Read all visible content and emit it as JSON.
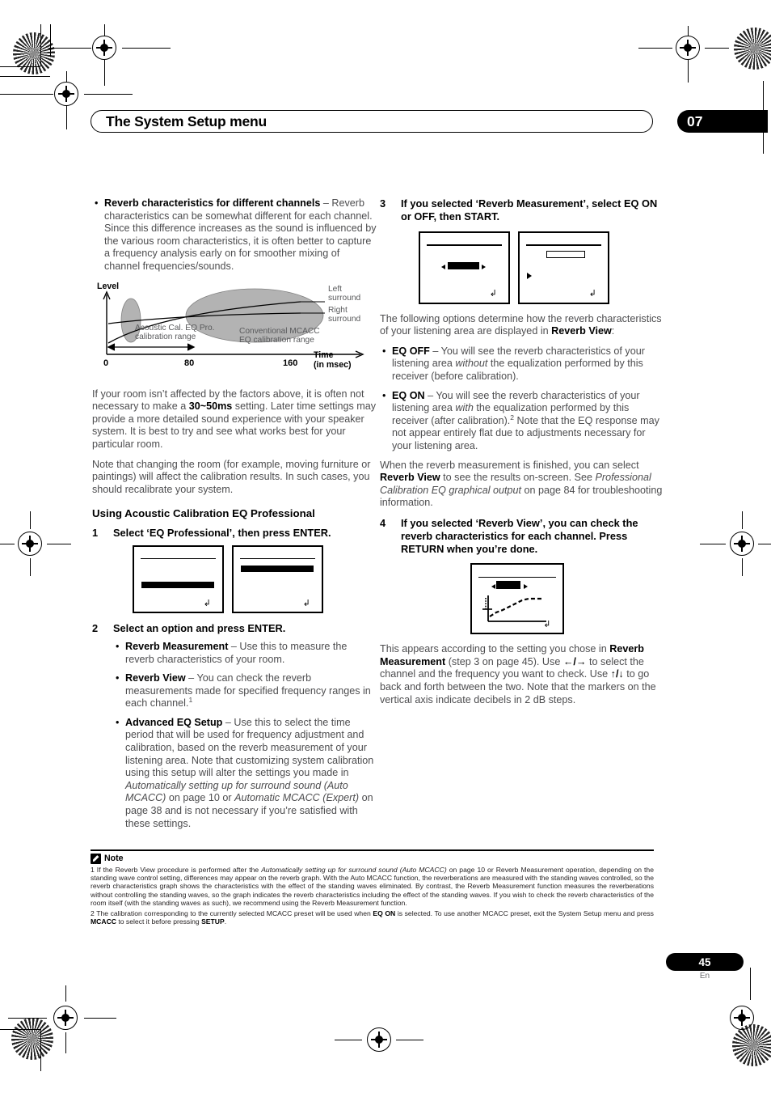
{
  "header": {
    "title": "The System Setup menu",
    "chapter": "07"
  },
  "page_footer": {
    "number": "45",
    "language": "En"
  },
  "left_column": {
    "bullet_reverb_channels": {
      "term": "Reverb characteristics for different channels",
      "dash": " – ",
      "text": "Reverb characteristics can be somewhat different for each channel. Since this difference increases as the sound is influenced by the various room characteristics, it is often better to capture a frequency analysis early on for smoother mixing of channel frequencies/sounds."
    },
    "diagram": {
      "y_axis_label": "Level",
      "x_axis_label": "Time",
      "x_axis_unit": "(in msec)",
      "x_ticks": [
        "0",
        "80",
        "160"
      ],
      "label_left_surround": "Left\nsurround",
      "label_left_surround_line1": "Left",
      "label_left_surround_line2": "surround",
      "label_right_surround_line1": "Right",
      "label_right_surround_line2": "surround",
      "label_acoustic_line1": "Acoustic Cal. EQ Pro.",
      "label_acoustic_line2": "calibration range",
      "label_conventional_line1": "Conventional MCACC",
      "label_conventional_line2": "EQ calibration range"
    },
    "para_room_factors_a": "If your room isn’t affected by the factors above, it is often not necessary to make a ",
    "para_room_factors_b": "30~50ms",
    "para_room_factors_c": " setting. Later time settings may provide a more detailed sound experience with your speaker system. It is best to try and see what works best for your particular room.",
    "para_changing_room": "Note that changing the room (for example, moving furniture or paintings) will affect the calibration results. In such cases, you should recalibrate your system.",
    "subhead_using": "Using Acoustic Calibration EQ Professional",
    "step1": {
      "num": "1",
      "text": "Select ‘EQ Professional’, then press ENTER."
    },
    "step2": {
      "num": "2",
      "text": "Select an option and press ENTER."
    },
    "step2_bullets": [
      {
        "term": "Reverb Measurement",
        "dash": " – ",
        "text": "Use this to measure the reverb characteristics of your room."
      },
      {
        "term": "Reverb View",
        "dash": " – ",
        "text": "You can check the reverb measurements made for specified frequency ranges in each channel.",
        "footnote_ref": "1"
      },
      {
        "term": "Advanced EQ Setup",
        "dash": " – ",
        "text_1": "Use this to select the time period that will be used for frequency adjustment and calibration, based on the reverb measurement of your listening area. Note that customizing system calibration using this setup will alter the settings you made in ",
        "italic_1": "Automatically setting up for surround sound (Auto MCACC)",
        "text_2": " on page 10 or ",
        "italic_2": "Automatic MCACC (Expert)",
        "text_3": " on page 38 and is not necessary if you’re satisfied with these settings."
      }
    ]
  },
  "right_column": {
    "step3": {
      "num": "3",
      "text": "If you selected ‘Reverb Measurement’, select EQ ON or OFF, then START."
    },
    "para_following_a": "The following options determine how the reverb characteristics of your listening area are displayed in ",
    "para_following_b": "Reverb View",
    "para_following_c": ":",
    "eq_bullets": [
      {
        "term": "EQ OFF",
        "dash": " – ",
        "text_1": "You will see the reverb characteristics of your listening area ",
        "italic_1": "without",
        "text_2": " the equalization performed by this receiver (before calibration)."
      },
      {
        "term": "EQ ON",
        "dash": " – ",
        "text_1": "You will see the reverb characteristics of your listening area ",
        "italic_1": "with",
        "text_2": " the equalization performed by this receiver (after calibration).",
        "footnote_ref": "2",
        "text_3": " Note that the EQ response may not appear entirely flat due to adjustments necessary for your listening area."
      }
    ],
    "para_when_finished_a": "When the reverb measurement is finished, you can select ",
    "para_when_finished_b": "Reverb View",
    "para_when_finished_c": " to see the results on-screen. See ",
    "para_when_finished_italic": "Professional Calibration EQ graphical output",
    "para_when_finished_d": " on page 84 for troubleshooting information.",
    "step4": {
      "num": "4",
      "text": "If you selected ‘Reverb View’, you can check the reverb characteristics for each channel. Press RETURN when you’re done."
    },
    "para_appears_a": "This appears according to the setting you chose in ",
    "para_appears_b": "Reverb Measurement",
    "para_appears_c": " (step 3 on page 45). Use ",
    "para_appears_arrows_lr": "←/→",
    "para_appears_d": " to select the channel and the frequency you want to check. Use ",
    "para_appears_arrows_ud": "↑/↓",
    "para_appears_e": " to go back and forth between the two. Note that the markers on the vertical axis indicate decibels in 2 dB steps."
  },
  "screens": {
    "return_glyph": "↲"
  },
  "notes": {
    "label": "Note",
    "icon": "pencil-icon",
    "footnote1_a": "1 If the Reverb View procedure is performed after the ",
    "footnote1_italic": "Automatically setting up for surround sound (Auto MCACC)",
    "footnote1_b": " on page 10 or Reverb Measurement operation, depending on the standing wave control setting, differences may appear on the reverb graph. With the Auto MCACC function, the reverberations are measured with the standing waves controlled, so the reverb characteristics graph shows the characteristics with the effect of the standing waves eliminated. By contrast, the Reverb Measurement function measures the reverberations without controlling the standing waves, so the graph indicates the reverb characteristics including the effect of the standing waves. If you wish to check the reverb characteristics of the room itself (with the standing waves as such), we recommend using the Reverb Measurement function.",
    "footnote2_a": "2 The calibration corresponding to the currently selected MCACC preset will be used when ",
    "footnote2_b": "EQ ON",
    "footnote2_c": " is selected. To use another MCACC preset, exit the System Setup menu and press ",
    "footnote2_d": "MCACC",
    "footnote2_e": " to select it before pressing ",
    "footnote2_f": "SETUP",
    "footnote2_g": "."
  }
}
